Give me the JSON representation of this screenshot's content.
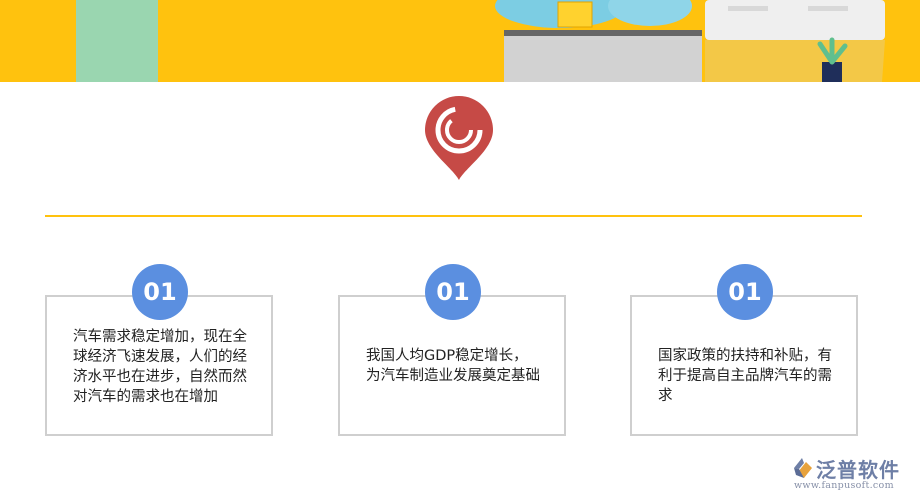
{
  "cards": [
    {
      "badge": "01",
      "text": "汽车需求稳定增加，现在全球经济飞速发展，人们的经济水平也在进步，自然而然对汽车的需求也在增加"
    },
    {
      "badge": "01",
      "text": "我国人均GDP稳定增长，为汽车制造业发展奠定基础"
    },
    {
      "badge": "01",
      "text": "国家政策的扶持和补贴，有利于提高自主品牌汽车的需求"
    }
  ],
  "logo": {
    "name": "泛普软件",
    "url": "www.fanpusoft.com"
  },
  "icons": {
    "pin": "location-pin-icon",
    "logo": "fanpu-logo-icon"
  },
  "colors": {
    "banner": "#FFC20E",
    "badge": "#5B8FE0",
    "pin": "#C64A46",
    "divider": "#FFC20E"
  }
}
